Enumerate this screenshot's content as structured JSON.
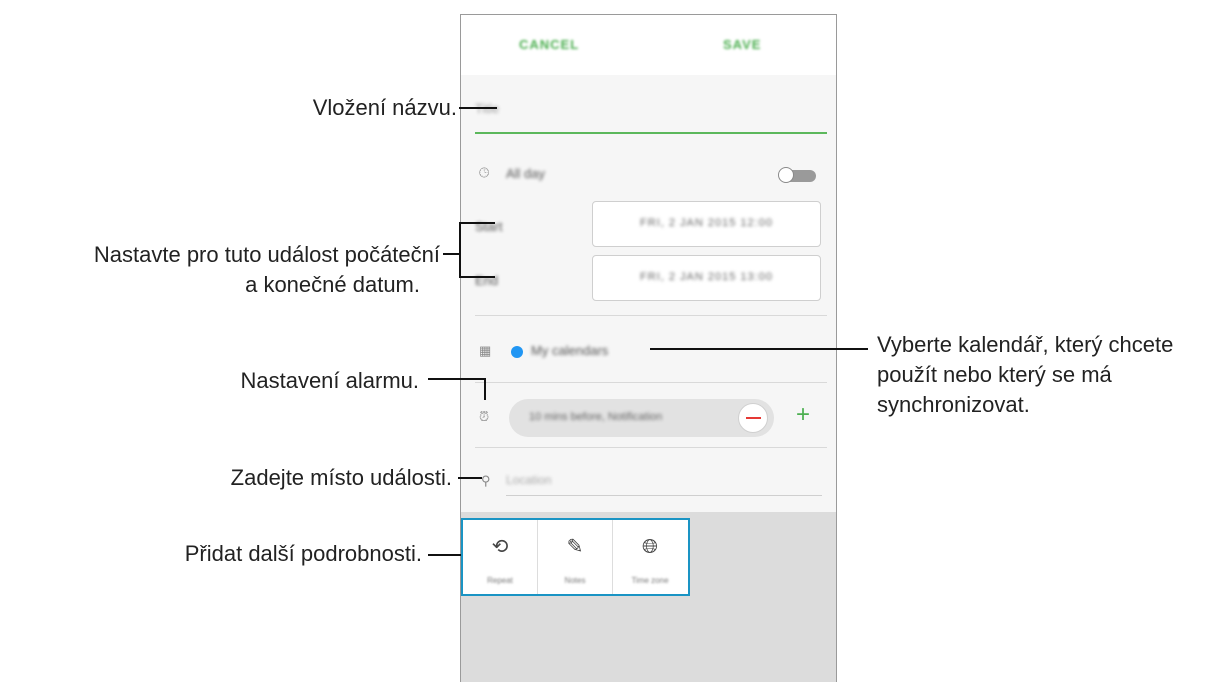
{
  "screen": {
    "top_bar": {
      "cancel_label": "CANCEL",
      "save_label": "SAVE"
    },
    "title_placeholder": "Title",
    "all_day": {
      "label": "All day",
      "toggle_on": false
    },
    "start": {
      "label": "Start",
      "value": "FRI, 2 JAN 2015 12:00"
    },
    "end": {
      "label": "End",
      "value": "FRI, 2 JAN 2015 13:00"
    },
    "calendar": {
      "label": "My calendars",
      "dot_color": "#2196f3"
    },
    "alarm": {
      "value": "10 mins before, Notification"
    },
    "location_placeholder": "Location",
    "options": [
      {
        "icon": "repeat-icon",
        "label": "Repeat"
      },
      {
        "icon": "notes-icon",
        "label": "Notes"
      },
      {
        "icon": "time-zone-icon",
        "label": "Time zone"
      }
    ],
    "accent_color": "#4caf50",
    "highlight_color": "#1a94c4"
  },
  "annotations": {
    "title": "Vložení názvu.",
    "dates_line1": "Nastavte pro tuto událost počáteční",
    "dates_line2": "a konečné datum.",
    "alarm": "Nastavení alarmu.",
    "location": "Zadejte místo události.",
    "details": "Přidat další podrobnosti.",
    "calendar_line1": "Vyberte kalendář, který chcete",
    "calendar_line2": "použít nebo který se má",
    "calendar_line3": "synchronizovat."
  }
}
